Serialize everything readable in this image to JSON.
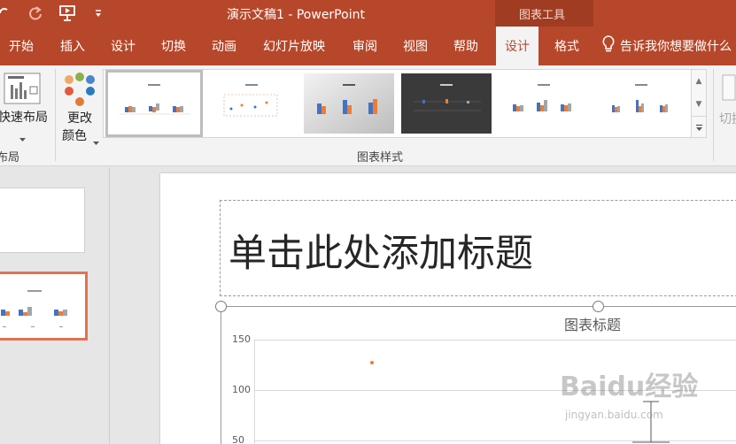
{
  "window": {
    "app_title": "演示文稿1  -  PowerPoint",
    "context_tab_group": "图表工具"
  },
  "qat": {
    "undo_icon": "undo-icon",
    "redo_icon": "redo-icon",
    "present_icon": "present-from-start-icon",
    "customize_icon": "qat-customize-icon"
  },
  "tabs": [
    {
      "label": "开始"
    },
    {
      "label": "插入"
    },
    {
      "label": "设计"
    },
    {
      "label": "切换"
    },
    {
      "label": "动画"
    },
    {
      "label": "幻灯片放映"
    },
    {
      "label": "审阅"
    },
    {
      "label": "视图"
    },
    {
      "label": "帮助"
    },
    {
      "label": "设计",
      "active": true
    },
    {
      "label": "格式"
    }
  ],
  "tell_me": "告诉我你想要做什么",
  "ribbon": {
    "quick_layout_label": "快速布局",
    "quick_layout_group": "布局",
    "change_colors_line1": "更改",
    "change_colors_line2": "颜色",
    "chart_styles_group": "图表样式",
    "switch_label": "切换"
  },
  "colors": {
    "accent": "#b7472a",
    "series_blue": "#4472c4",
    "series_orange": "#ed7d31",
    "series_gray": "#a5a5a5"
  },
  "slide": {
    "title_placeholder": "单击此处添加标题",
    "chart_title": "图表标题",
    "y_ticks": [
      "150",
      "100",
      "50"
    ]
  },
  "watermark": {
    "text": "Baidu经验",
    "url": "jingyan.baidu.com"
  }
}
